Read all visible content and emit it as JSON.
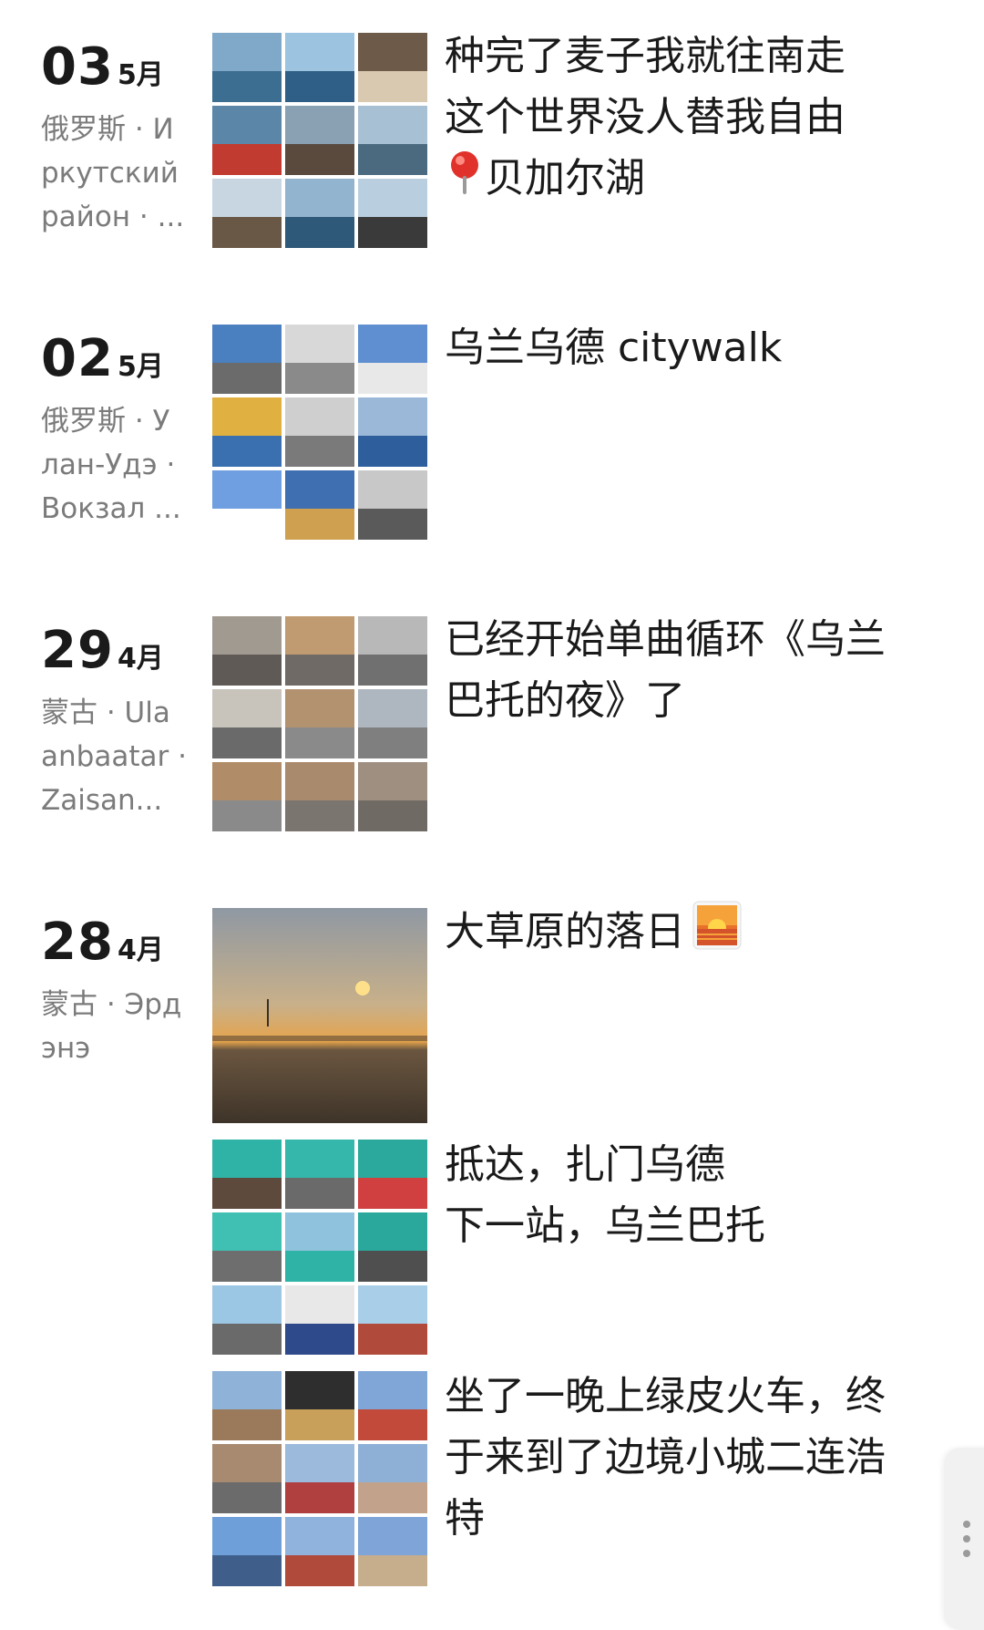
{
  "entries": [
    {
      "day": "03",
      "month": "5月",
      "location": "俄罗斯 · Иркутский район · ...",
      "caption": "种完了麦子我就往南走\n这个世界没人替我自由\n",
      "caption_tail": "贝加尔湖",
      "caption_icon": "red-pin-icon",
      "photo_count": 9,
      "photo_theme": "lake"
    },
    {
      "day": "02",
      "month": "5月",
      "location": "俄罗斯 · Улан-Удэ · Вокзал ...",
      "caption": "乌兰乌德 citywalk",
      "photo_count": 9,
      "photo_theme": "city"
    },
    {
      "day": "29",
      "month": "4月",
      "location": "蒙古 · Ulaanbaatar · Zaisan...",
      "caption": "已经开始单曲循环《乌兰巴托的夜》了",
      "photo_count": 9,
      "photo_theme": "hills"
    },
    {
      "day": "28",
      "month": "4月",
      "location": "蒙古 · Эрдэнэ",
      "posts": [
        {
          "caption": "大草原的落日",
          "caption_icon": "sunset-icon",
          "photo_count": 1,
          "photo_theme": "sunset"
        },
        {
          "caption": "抵达，扎门乌德\n下一站，乌兰巴托",
          "photo_count": 9,
          "photo_theme": "train"
        },
        {
          "caption": "坐了一晚上绿皮火车，终于来到了边境小城二连浩特",
          "photo_count": 9,
          "photo_theme": "border"
        }
      ]
    }
  ],
  "colors": {
    "text": "#1a1a1a",
    "meta": "#7b7b7b",
    "background": "#ffffff"
  }
}
